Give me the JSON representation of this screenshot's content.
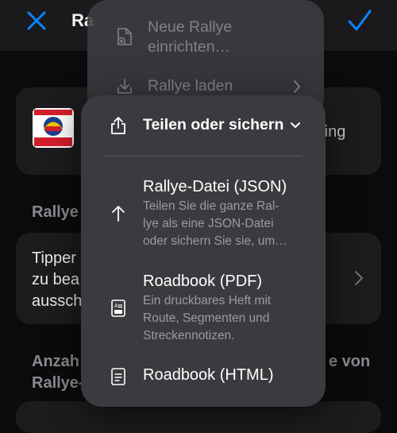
{
  "header": {
    "title_peek": "Ra"
  },
  "background": {
    "card1_peek": "ring",
    "section1_peek": "Rallye",
    "card2_lines": [
      "Tipper",
      "zu bea",
      "aussch"
    ],
    "section2_left": [
      "Anzah",
      "Rallye-"
    ],
    "section2_right": "e von"
  },
  "menu_back": {
    "new_rally": [
      "Neue Rallye",
      "einrichten…"
    ],
    "load_rally": "Rallye laden"
  },
  "menu_front": {
    "header": "Teilen oder sichern",
    "options": [
      {
        "title": "Rallye-Datei (JSON)",
        "description": [
          "Teilen Sie die ganze Ral-",
          "lye als eine JSON-Datei",
          "oder sichern Sie sie, um…"
        ],
        "icon": "arrow-up-icon"
      },
      {
        "title": "Roadbook (PDF)",
        "description": [
          "Ein druckbares Heft mit",
          "Route, Segmenten und",
          "Streckennotizen."
        ],
        "icon": "pdf-document-icon"
      },
      {
        "title": "Roadbook (HTML)",
        "description": [],
        "icon": "html-document-icon"
      }
    ]
  },
  "colors": {
    "accent": "#0a84ff",
    "menu_bg": "#3b3b3f",
    "screen_bg": "#0b0b0d"
  }
}
